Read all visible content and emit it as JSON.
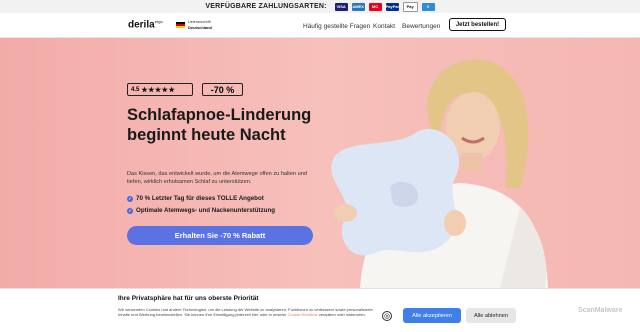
{
  "topbar": {
    "label": "VERFÜGBARE ZAHLUNGSARTEN:",
    "payments": [
      {
        "name": "VISA",
        "color": "#1a1f71"
      },
      {
        "name": "AMEX",
        "color": "#2e77bc"
      },
      {
        "name": "MC",
        "color": "#eb001b"
      },
      {
        "name": "PayPal",
        "color": "#003087"
      },
      {
        "name": "Pay",
        "color": "#111111"
      },
      {
        "name": "V",
        "color": "#2f8cd6"
      }
    ]
  },
  "header": {
    "logo": "derila",
    "logo_sup": "ergo",
    "supplier_line1": "Lieferanschrift",
    "supplier_line2": "Deutschland",
    "nav": [
      "Häufig gestellte Fragen",
      "Kontakt",
      "Bewertungen"
    ],
    "cta": "Jetzt bestellen!"
  },
  "hero": {
    "rating_value": "4.5",
    "stars": "★★★★★",
    "discount": "-70 %",
    "headline": "Schlafapnoe-Linderung beginnt heute Nacht",
    "subtext": "Das Kissen, das entwickelt wurde, um die Atemwege offen zu halten und tiefen, wirklich erholsamen Schlaf zu unterstützen.",
    "bullets": [
      "70 % Letzter Tag für dieses TOLLE Angebot",
      "Optimale Atemwegs- und Nackenunterstützung"
    ],
    "cta": "Erhalten Sie -70 % Rabatt"
  },
  "cookie": {
    "title": "Ihre Privatsphäre hat für uns oberste Priorität",
    "text": "Wir verwenden Cookies und andere Technologien, um die Leistung der Website zu analysieren, Funktionen zu verbessern sowie personalisierte Inhalte und Werbung bereitzustellen. Sie können Ihre Einwilligung jederzeit hier oder in unserer",
    "link": "Cookie-Richtlinie",
    "text_end": "verwalten oder widerrufen.",
    "accept": "Alle akzeptieren",
    "reject": "Alle ablehnen"
  },
  "watermark": "ScanMalware",
  "colors": {
    "hero_bg": "#f4b5b0",
    "accent": "#5b72e2",
    "accept": "#3f7fe8"
  }
}
